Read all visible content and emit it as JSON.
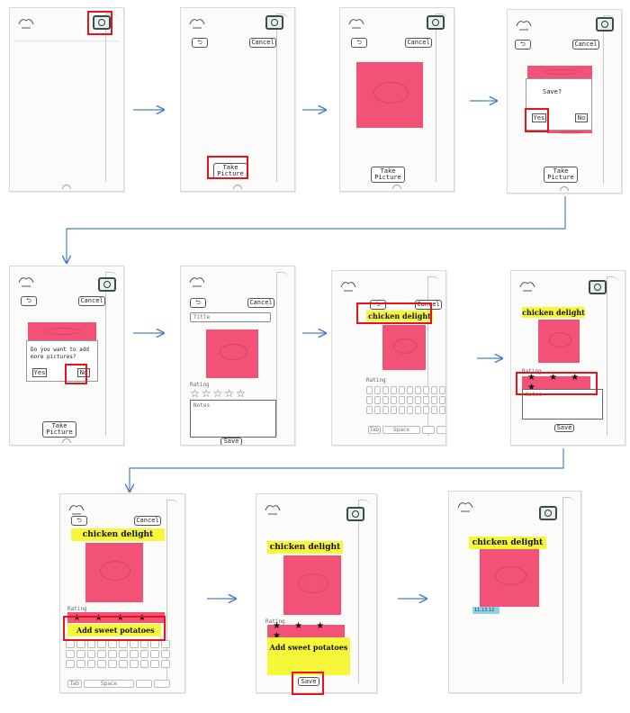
{
  "screen": {
    "cancel_label": "Cancel",
    "back_label": "⮌",
    "take_picture_label": "Take Picture",
    "save_prompt": "Save?",
    "yes_label": "Yes",
    "no_label": "No",
    "more_prompt": "Do you want to add more pictures?",
    "title_placeholder": "Title",
    "rating_label": "Rating",
    "notes_placeholder": "Notes",
    "save_label": "Save",
    "empty_stars": "☆☆☆☆☆",
    "filled_stars": "★ ★ ★ ★",
    "dish_title": "chicken delight",
    "note_text": "Add sweet potatoes",
    "space_key": "Space",
    "tab_key": "Tab",
    "date_tag": "11.13.12"
  },
  "colors": {
    "photo": "#f35277",
    "highlight": "#e8121d",
    "sticky": "#f6f63a",
    "arrow": "#4a7fc1",
    "tag": "#8ed3e5"
  }
}
